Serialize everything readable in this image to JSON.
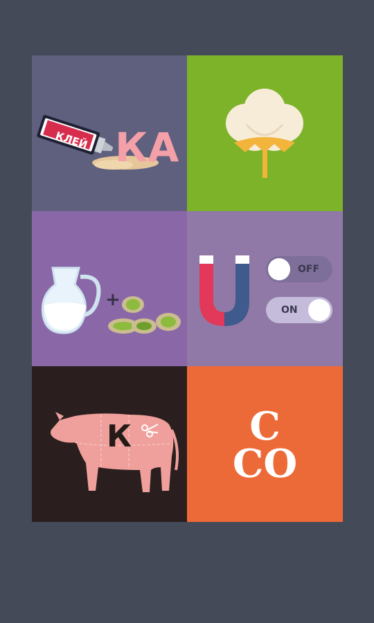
{
  "tiles": {
    "glue": {
      "tube_label": "КЛЕЙ",
      "letters": "КА",
      "icon": "glue-tube"
    },
    "cotton": {
      "icon": "cotton-flower"
    },
    "milk_pistachio": {
      "plus": "+",
      "icon": "milk-jug-and-pistachios"
    },
    "magnet": {
      "off_label": "OFF",
      "on_label": "ON",
      "icon": "horseshoe-magnet"
    },
    "cow": {
      "letter": "К",
      "icon": "cow-cut-diagram"
    },
    "soco": {
      "line1": "С",
      "line2": "СО"
    }
  },
  "colors": {
    "background": "#444a57",
    "glue_tile": "#5f5f7e",
    "cotton_tile": "#7db329",
    "milk_tile": "#8a68a8",
    "magnet_tile": "#9079a6",
    "cow_tile": "#2a1f1e",
    "soco_tile": "#ec6a38"
  }
}
